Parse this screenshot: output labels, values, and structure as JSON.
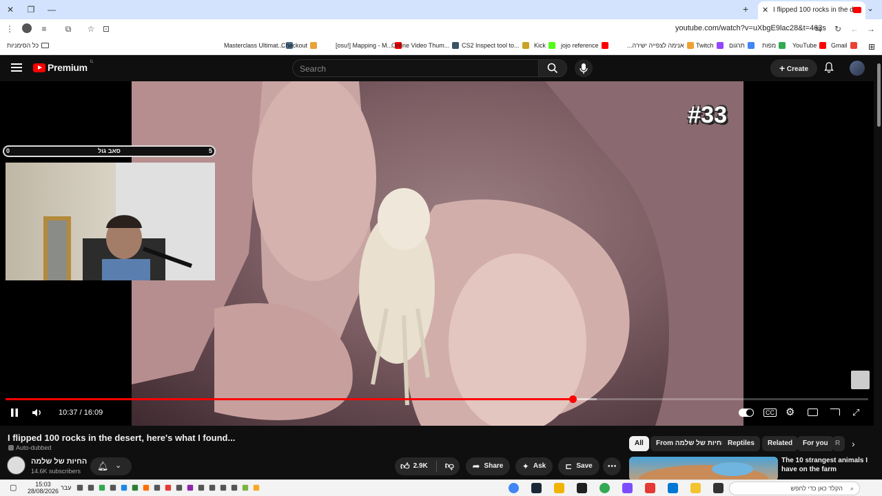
{
  "browser": {
    "tab_title": "I flipped 100 rocks in the de",
    "url": "youtube.com/watch?v=uXbgE9lac28&t=463s",
    "bookmarks": [
      {
        "label": "Masterclass Ultimat...",
        "color": "#4a6a8a"
      },
      {
        "label": "Checkout",
        "color": "#e8a23a"
      },
      {
        "label": "[osu!] Mapping - M...",
        "color": "#ff0000"
      },
      {
        "label": "Online Video Thum...",
        "color": "#3b5366"
      },
      {
        "label": "CS2 Inspect tool to...",
        "color": "#c9a227"
      },
      {
        "label": "Kick",
        "color": "#53fc18"
      },
      {
        "label": "jojo reference",
        "color": "#ff0000"
      },
      {
        "label": "...אנימה לצפייה ישירה",
        "color": "#f0a030"
      },
      {
        "label": "Twitch",
        "color": "#9146ff"
      },
      {
        "label": "תרגום",
        "color": "#4285f4"
      },
      {
        "label": "מפות",
        "color": "#34a853"
      },
      {
        "label": "YouTube",
        "color": "#ff0000"
      },
      {
        "label": "Gmail",
        "color": "#ea4335"
      }
    ],
    "all_bookmarks": "כל הסימניות"
  },
  "youtube": {
    "logo": "Premium",
    "region": "IL",
    "search_placeholder": "Search",
    "create_label": "Create"
  },
  "player": {
    "badge": "#33",
    "score_left": "0",
    "score_label": "סאב גול",
    "score_right": "5",
    "time": "10:37 / 16:09",
    "progress": 0.657,
    "buffered": 0.685,
    "accent": "#ff0000"
  },
  "video": {
    "title": "I flipped 100 rocks in the desert, here's what I found...",
    "auto_dubbed": "Auto-dubbed",
    "channel": "החיות של שלמה",
    "subscribers": "14.6K subscribers",
    "likes": "2.9K",
    "share": "Share",
    "ask": "Ask",
    "save": "Save"
  },
  "chips": [
    {
      "label": "All",
      "active": true
    },
    {
      "label": "From החיות של שלמה",
      "active": false
    },
    {
      "label": "Reptiles",
      "active": false
    },
    {
      "label": "Related",
      "active": false
    },
    {
      "label": "For you",
      "active": false
    },
    {
      "label": "R",
      "active": false
    }
  ],
  "recommended": {
    "title": "The 10 strangest animals I have on the farm"
  },
  "taskbar": {
    "time": "15:03",
    "date": "28/08/2026",
    "lang": "עבר",
    "search_placeholder": "הקלד כאן כדי לחפש"
  }
}
